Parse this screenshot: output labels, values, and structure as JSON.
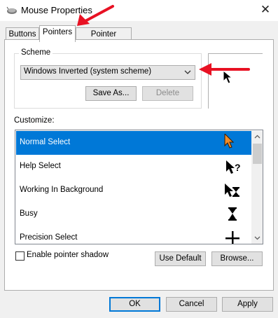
{
  "window": {
    "title": "Mouse Properties",
    "close_glyph": "✕"
  },
  "tabs": [
    {
      "label": "Buttons",
      "active": false
    },
    {
      "label": "Pointers",
      "active": true
    },
    {
      "label": "Pointer Options",
      "active": false
    }
  ],
  "scheme": {
    "group_label": "Scheme",
    "selected": "Windows Inverted (system scheme)",
    "save_as_label": "Save As...",
    "delete_label": "Delete",
    "delete_enabled": false
  },
  "customize": {
    "label": "Customize:",
    "items": [
      {
        "label": "Normal Select",
        "icon": "arrow-cursor-icon",
        "selected": true
      },
      {
        "label": "Help Select",
        "icon": "help-cursor-icon",
        "selected": false
      },
      {
        "label": "Working In Background",
        "icon": "working-cursor-icon",
        "selected": false
      },
      {
        "label": "Busy",
        "icon": "hourglass-cursor-icon",
        "selected": false
      },
      {
        "label": "Precision Select",
        "icon": "crosshair-cursor-icon",
        "selected": false
      }
    ]
  },
  "pointer_shadow": {
    "label": "Enable pointer shadow",
    "checked": false
  },
  "buttons": {
    "use_default": "Use Default",
    "browse": "Browse...",
    "ok": "OK",
    "cancel": "Cancel",
    "apply": "Apply"
  },
  "colors": {
    "selection": "#0078d7",
    "annotation_arrow": "#e81123",
    "preview_cursor": "#000000",
    "selected_cursor": "#f28c28"
  }
}
